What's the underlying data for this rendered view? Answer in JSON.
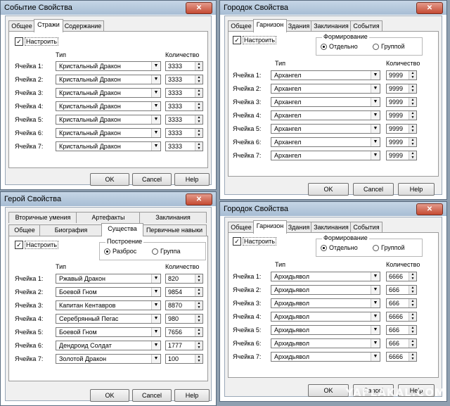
{
  "watermark": "YAPLAKAL.COM",
  "windows": [
    {
      "title": "Событие Свойства",
      "tabs": [
        "Общее",
        "Стражи",
        "Содержание"
      ],
      "checkbox": "Настроить",
      "headers": {
        "type": "Тип",
        "count": "Количество"
      },
      "cells": [
        {
          "label": "Ячейка 1:",
          "type": "Кристальный Дракон",
          "count": "3333"
        },
        {
          "label": "Ячейка 2:",
          "type": "Кристальный Дракон",
          "count": "3333"
        },
        {
          "label": "Ячейка 3:",
          "type": "Кристальный Дракон",
          "count": "3333"
        },
        {
          "label": "Ячейка 4:",
          "type": "Кристальный Дракон",
          "count": "3333"
        },
        {
          "label": "Ячейка 5:",
          "type": "Кристальный Дракон",
          "count": "3333"
        },
        {
          "label": "Ячейка 6:",
          "type": "Кристальный Дракон",
          "count": "3333"
        },
        {
          "label": "Ячейка 7:",
          "type": "Кристальный Дракон",
          "count": "3333"
        }
      ],
      "buttons": {
        "ok": "OK",
        "cancel": "Cancel",
        "help": "Help"
      }
    },
    {
      "title": "Городок Свойства",
      "tabs": [
        "Общее",
        "Гарнизон",
        "Здания",
        "Заклинания",
        "События"
      ],
      "checkbox": "Настроить",
      "group": {
        "caption": "Формирование",
        "opt1": "Отдельно",
        "opt2": "Группой"
      },
      "headers": {
        "type": "Тип",
        "count": "Количество"
      },
      "cells": [
        {
          "label": "Ячейка 1:",
          "type": "Архангел",
          "count": "9999"
        },
        {
          "label": "Ячейка 2:",
          "type": "Архангел",
          "count": "9999"
        },
        {
          "label": "Ячейка 3:",
          "type": "Архангел",
          "count": "9999"
        },
        {
          "label": "Ячейка 4:",
          "type": "Архангел",
          "count": "9999"
        },
        {
          "label": "Ячейка 5:",
          "type": "Архангел",
          "count": "9999"
        },
        {
          "label": "Ячейка 6:",
          "type": "Архангел",
          "count": "9999"
        },
        {
          "label": "Ячейка 7:",
          "type": "Архангел",
          "count": "9999"
        }
      ],
      "buttons": {
        "ok": "OK",
        "cancel": "Cancel",
        "help": "Help"
      }
    },
    {
      "title": "Герой Свойства",
      "tabs_back": [
        "Вторичные умения",
        "Артефакты",
        "Заклинания"
      ],
      "tabs": [
        "Общее",
        "Биография",
        "Существа",
        "Первичные навыки"
      ],
      "checkbox": "Настроить",
      "group": {
        "caption": "Построение",
        "opt1": "Разброс",
        "opt2": "Группа"
      },
      "headers": {
        "type": "Тип",
        "count": "Количество"
      },
      "cells": [
        {
          "label": "Ячейка 1:",
          "type": "Ржавый Дракон",
          "count": "820"
        },
        {
          "label": "Ячейка 2:",
          "type": "Боевой Гном",
          "count": "9854"
        },
        {
          "label": "Ячейка 3:",
          "type": "Капитан Кентавров",
          "count": "8870"
        },
        {
          "label": "Ячейка 4:",
          "type": "Серебрянный Пегас",
          "count": "980"
        },
        {
          "label": "Ячейка 5:",
          "type": "Боевой Гном",
          "count": "7656"
        },
        {
          "label": "Ячейка 6:",
          "type": "Дендроид Солдат",
          "count": "1777"
        },
        {
          "label": "Ячейка 7:",
          "type": "Золотой Дракон",
          "count": "100"
        }
      ],
      "buttons": {
        "ok": "OK",
        "cancel": "Cancel",
        "help": "Help"
      }
    },
    {
      "title": "Городок Свойства",
      "tabs": [
        "Общее",
        "Гарнизон",
        "Здания",
        "Заклинания",
        "События"
      ],
      "checkbox": "Настроить",
      "group": {
        "caption": "Формирование",
        "opt1": "Отдельно",
        "opt2": "Группой"
      },
      "headers": {
        "type": "Тип",
        "count": "Количество"
      },
      "cells": [
        {
          "label": "Ячейка 1:",
          "type": "Архидьявол",
          "count": "6666"
        },
        {
          "label": "Ячейка 2:",
          "type": "Архидьявол",
          "count": "666"
        },
        {
          "label": "Ячейка 3:",
          "type": "Архидьявол",
          "count": "666"
        },
        {
          "label": "Ячейка 4:",
          "type": "Архидьявол",
          "count": "6666"
        },
        {
          "label": "Ячейка 5:",
          "type": "Архидьявол",
          "count": "666"
        },
        {
          "label": "Ячейка 6:",
          "type": "Архидьявол",
          "count": "666"
        },
        {
          "label": "Ячейка 7:",
          "type": "Архидьявол",
          "count": "6666"
        }
      ],
      "buttons": {
        "ok": "OK",
        "cancel": "Cancel",
        "help": "Help"
      }
    }
  ]
}
